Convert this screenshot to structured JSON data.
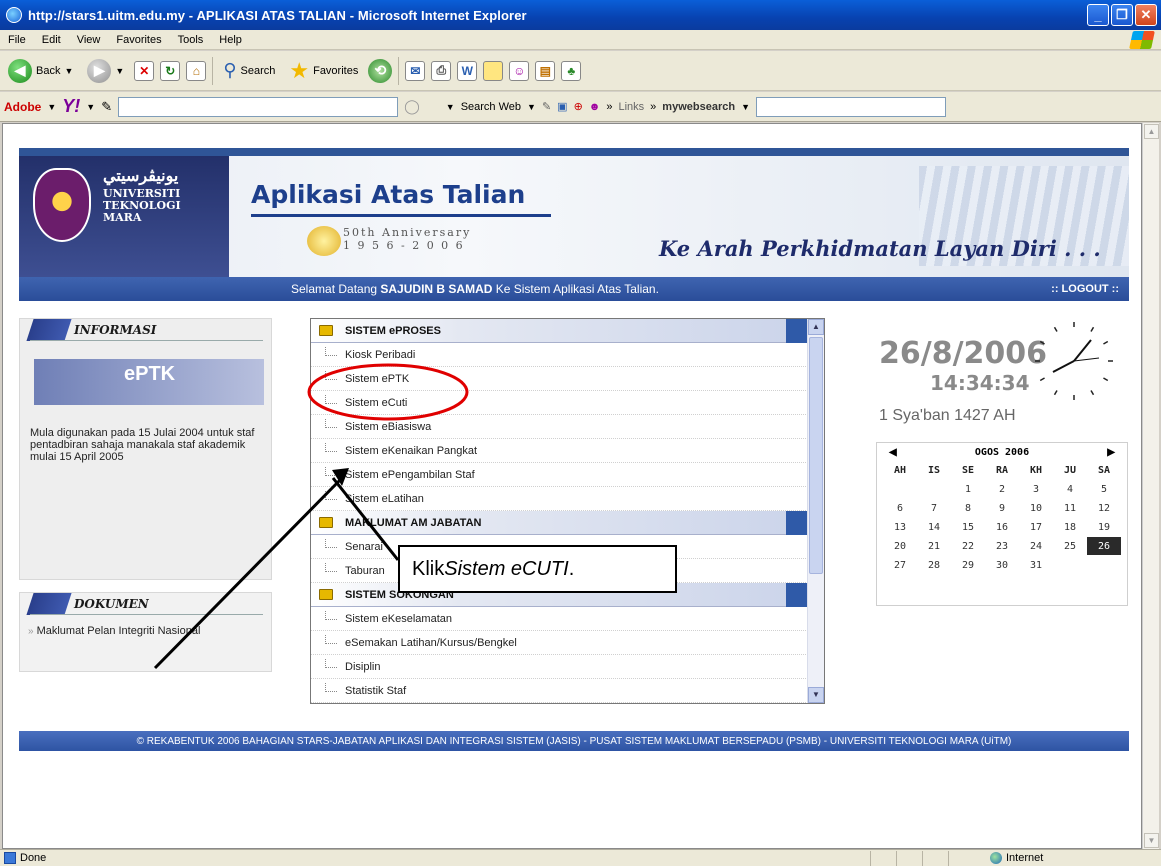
{
  "window": {
    "title": "http://stars1.uitm.edu.my - APLIKASI ATAS TALIAN - Microsoft Internet Explorer",
    "minimize": "_",
    "maximize": "❐",
    "close": "✕"
  },
  "menubar": [
    "File",
    "Edit",
    "View",
    "Favorites",
    "Tools",
    "Help"
  ],
  "toolbar": {
    "back": "Back",
    "search": "Search",
    "favorites": "Favorites"
  },
  "linkbar": {
    "adobe": "Adobe",
    "search_web": "Search Web",
    "links": "Links",
    "mywebsearch": "mywebsearch",
    "chevron": "»"
  },
  "header": {
    "jawi": "ﯾﻮﻧﻴﭭﺮﺳﻴﺘﻲ",
    "uni_line1": "UNIVERSITI",
    "uni_line2": "TEKNOLOGI",
    "uni_line3": "MARA",
    "app_title": "Aplikasi Atas Talian",
    "anniversary": "50th Anniversary",
    "anniversary_years": "1 9 5 6 - 2 0 0 6",
    "slogan": "Ke Arah Perkhidmatan Layan Diri . . .",
    "welcome_prefix": "Selamat Datang ",
    "welcome_name": "SAJUDIN B SAMAD",
    "welcome_suffix": " Ke Sistem Aplikasi Atas Talian.",
    "logout": ":: LOGOUT ::"
  },
  "informasi": {
    "title": "INFORMASI",
    "banner_title": "ePTK",
    "text": "Mula digunakan pada 15 Julai 2004 untuk staf pentadbiran sahaja manakala staf akademik mulai 15 April 2005"
  },
  "dokumen": {
    "title": "DOKUMEN",
    "item": "Maklumat Pelan Integriti Nasional"
  },
  "menu": {
    "sections": [
      {
        "title": "SISTEM ePROSES",
        "items": [
          "Kiosk Peribadi",
          "Sistem ePTK",
          "Sistem eCuti",
          "Sistem eBiasiswa",
          "Sistem eKenaikan Pangkat",
          "Sistem ePengambilan Staf",
          "Sistem eLatihan"
        ]
      },
      {
        "title": "MAKLUMAT AM JABATAN",
        "items": [
          "Senarai",
          "Taburan"
        ]
      },
      {
        "title": "SISTEM SOKONGAN",
        "items": [
          "Sistem eKeselamatan",
          "eSemakan Latihan/Kursus/Bengkel",
          "Disiplin",
          "Statistik Staf"
        ]
      }
    ]
  },
  "clock": {
    "date": "26/8/2006",
    "time": "14:34:34",
    "hijri": "1 Sya'ban 1427 AH"
  },
  "calendar": {
    "month": "OGOS 2006",
    "prev": "◀",
    "next": "▶",
    "dow": [
      "AH",
      "IS",
      "SE",
      "RA",
      "KH",
      "JU",
      "SA"
    ],
    "offset": 2,
    "days": 31,
    "today": 26
  },
  "footer": "© REKABENTUK 2006 BAHAGIAN STARS-JABATAN APLIKASI DAN INTEGRASI SISTEM (JASIS) - PUSAT SISTEM MAKLUMAT BERSEPADU (PSMB) - UNIVERSITI TEKNOLOGI MARA (UiTM)",
  "callout": {
    "prefix": "Klik ",
    "emphasis": "Sistem eCUTI",
    "suffix": " ."
  },
  "status": {
    "left": "Done",
    "zone": "Internet"
  }
}
